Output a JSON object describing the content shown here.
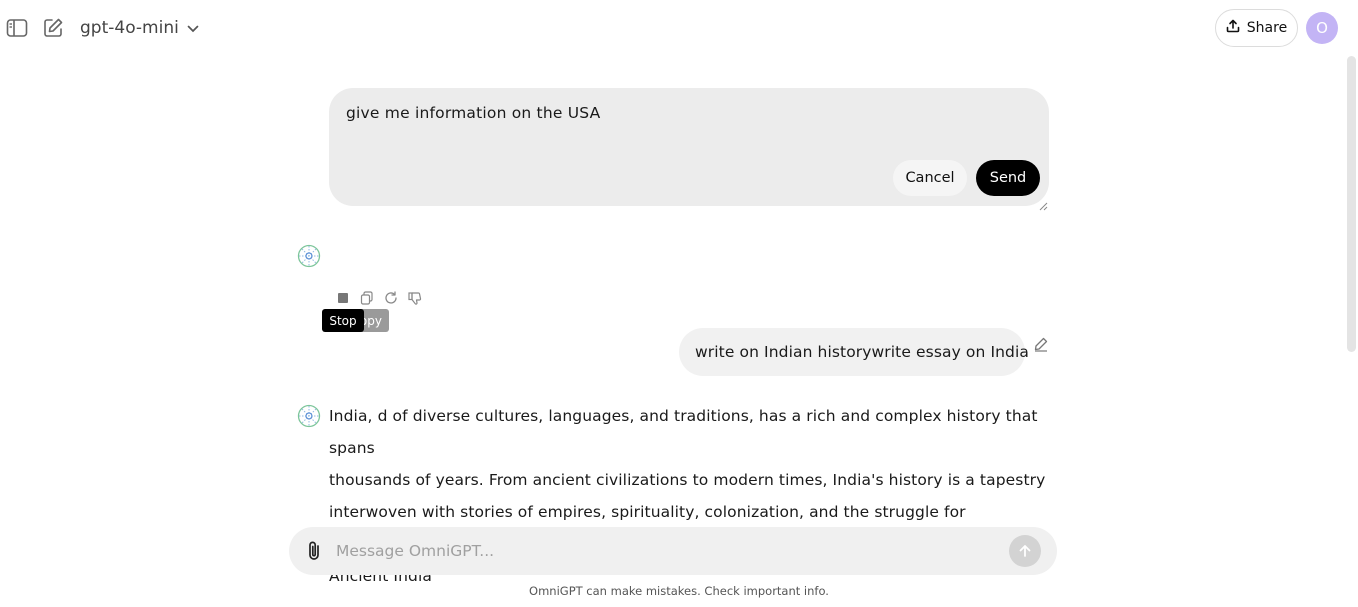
{
  "header": {
    "model_name": "gpt-4o-mini",
    "share_label": "Share",
    "avatar_initial": "O"
  },
  "edit_box": {
    "text": "give me information on the USA",
    "cancel_label": "Cancel",
    "send_label": "Send"
  },
  "tooltips": {
    "copy": "Copy",
    "stop": "Stop"
  },
  "user_message": "write on Indian historywrite essay on India",
  "assistant_response": {
    "line1": "India, d of diverse cultures, languages, and traditions, has a rich and complex history that spans",
    "line2": "thousands of years. From ancient civilizations to modern times, India's history is a tapestry",
    "line3": "interwoven with stories of empires, spirituality, colonization, and the struggle for independence.",
    "line4": "Ancient India"
  },
  "composer": {
    "placeholder": "Message OmniGPT..."
  },
  "footer": "OmniGPT can make mistakes. Check important info.",
  "icons": [
    "sidebar-toggle-icon",
    "new-chat-icon",
    "chevron-down-icon",
    "upload-icon",
    "bot-logo-icon",
    "stop-icon",
    "copy-icon",
    "regenerate-icon",
    "thumbs-down-icon",
    "pencil-icon",
    "paperclip-icon",
    "arrow-up-icon"
  ],
  "colors": {
    "send_button": "#000000",
    "avatar_bg": "#c3b4f5",
    "edit_box_bg": "#ececec",
    "composer_bg": "#f0f0f0"
  }
}
